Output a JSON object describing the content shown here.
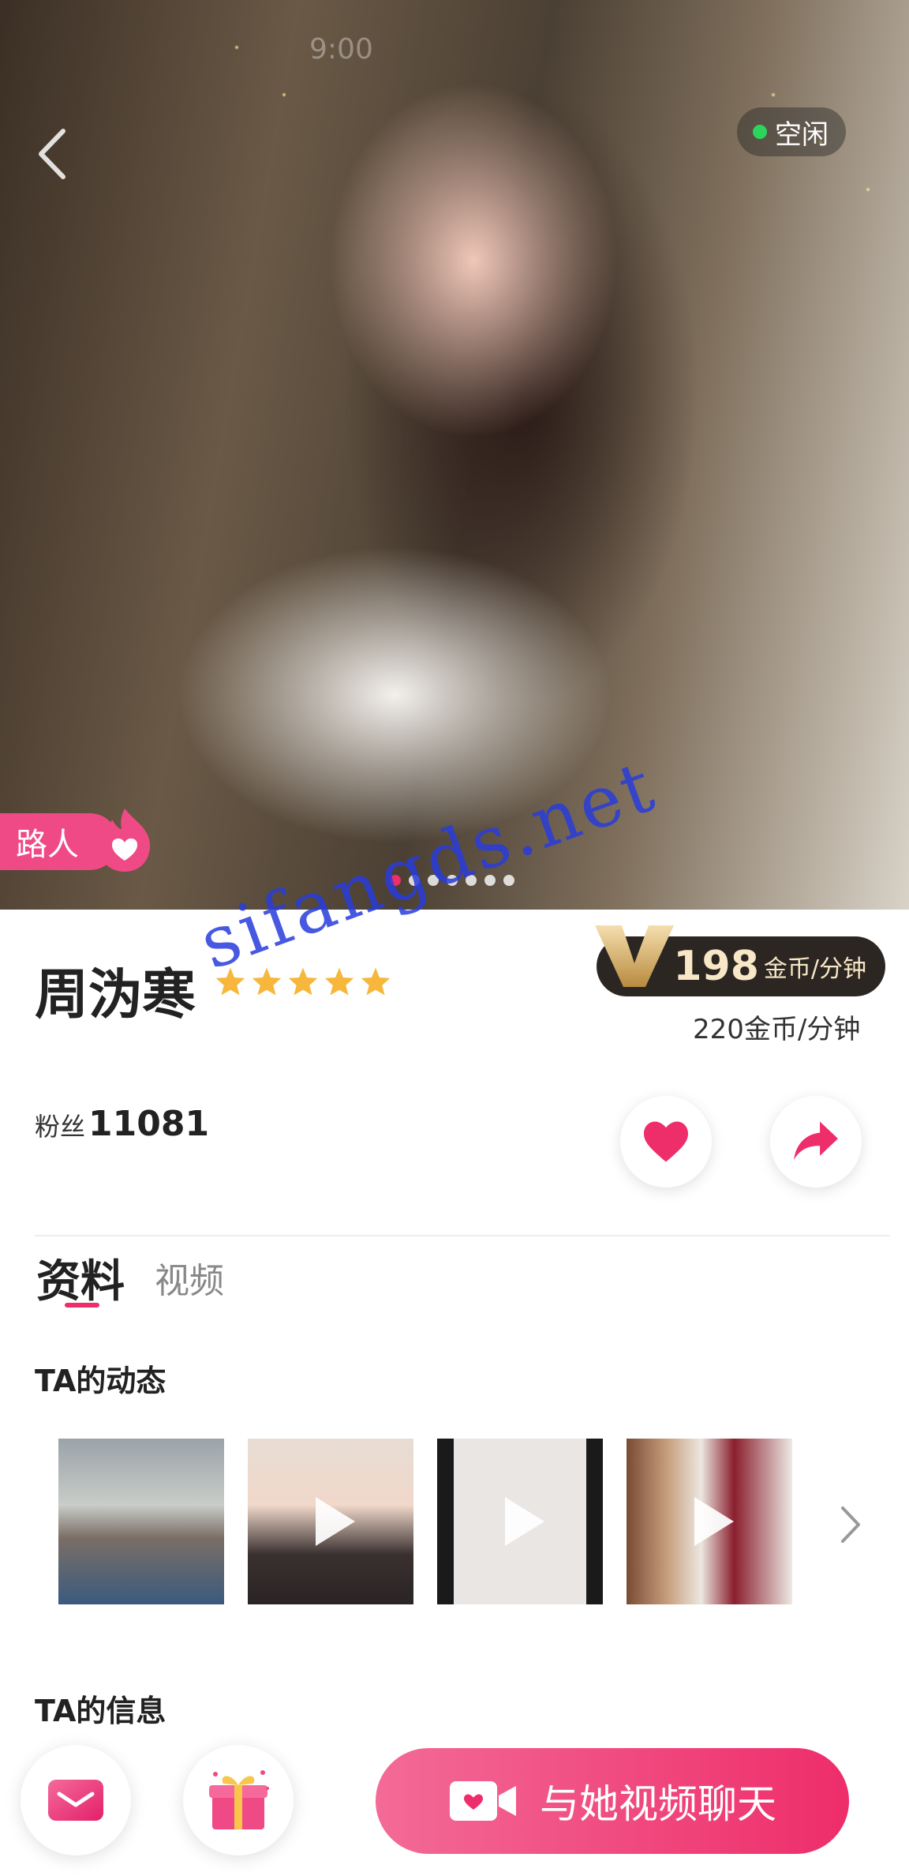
{
  "status_bar": {
    "time": "9:00"
  },
  "hero": {
    "online_status": "空闲",
    "badge_label": "路人",
    "carousel_total": 7,
    "carousel_active_index": 0
  },
  "profile": {
    "name": "周沩寒",
    "star_rating": 5,
    "price_value": "198",
    "price_unit": "金币/分钟",
    "original_price": "220金币/分钟",
    "fans_label": "粉丝",
    "fans_count": "11081"
  },
  "tabs": [
    {
      "label": "资料",
      "active": true
    },
    {
      "label": "视频",
      "active": false
    }
  ],
  "sections": {
    "moments_title": "TA的动态",
    "info_title": "TA的信息"
  },
  "moments": [
    {
      "type": "photo"
    },
    {
      "type": "video"
    },
    {
      "type": "video"
    },
    {
      "type": "video"
    }
  ],
  "bottom_bar": {
    "video_chat_label": "与她视频聊天"
  },
  "watermark": "sifangds.net",
  "colors": {
    "accent": "#ee2d6b",
    "price_pill": "#2c2623",
    "price_text": "#f7e7c6",
    "status_online": "#2bd45a"
  }
}
